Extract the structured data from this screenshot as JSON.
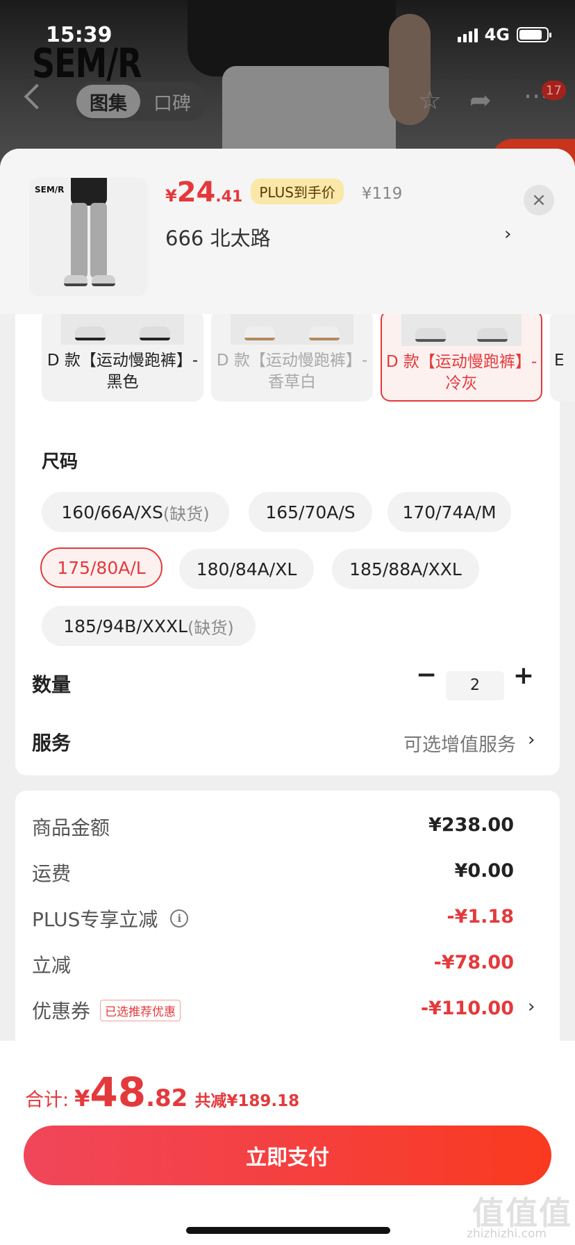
{
  "status_bar": {
    "time": "15:39",
    "network": "4G",
    "battery_level": 0.85
  },
  "background": {
    "brand_logo": "SEM/R"
  },
  "nav": {
    "tabs": [
      {
        "label": "图集",
        "active": true
      },
      {
        "label": "口碑",
        "active": false
      }
    ],
    "cart_badge": "17",
    "icons": [
      "back-icon",
      "star-icon",
      "share-icon",
      "more-icon"
    ]
  },
  "product": {
    "thumb_brand": "SEM/R",
    "price_symbol": "¥",
    "price_int": "24",
    "price_dec": ".41",
    "plus_tag": "PLUS到手价",
    "original_price": "¥119",
    "sku_name": "666  北太路",
    "close_icon": "×"
  },
  "colors": [
    {
      "label": "D 款【运动慢跑裤】-黑色",
      "state": "normal"
    },
    {
      "label": "D 款【运动慢跑裤】-香草白",
      "state": "disabled"
    },
    {
      "label": "D 款【运动慢跑裤】-冷灰",
      "state": "selected"
    },
    {
      "label": "E",
      "state": "normal"
    }
  ],
  "size": {
    "title": "尺码",
    "options": [
      {
        "label": "160/66A/XS",
        "note": "(缺货)",
        "state": "disabled"
      },
      {
        "label": "165/70A/S",
        "note": "",
        "state": "normal"
      },
      {
        "label": "170/74A/M",
        "note": "",
        "state": "normal"
      },
      {
        "label": "175/80A/L",
        "note": "",
        "state": "selected"
      },
      {
        "label": "180/84A/XL",
        "note": "",
        "state": "normal"
      },
      {
        "label": "185/88A/XXL",
        "note": "",
        "state": "normal"
      },
      {
        "label": "185/94B/XXXL",
        "note": "(缺货)",
        "state": "disabled"
      }
    ]
  },
  "quantity": {
    "label": "数量",
    "value": "2",
    "minus": "−",
    "plus": "+"
  },
  "service": {
    "label": "服务",
    "value": "可选增值服务",
    "arrow": "›"
  },
  "price_breakdown": [
    {
      "label": "商品金额",
      "value": "¥238.00",
      "red": false
    },
    {
      "label": "运费",
      "value": "¥0.00",
      "red": false
    },
    {
      "label": "PLUS专享立减",
      "value": "-¥1.18",
      "red": true,
      "info": "i"
    },
    {
      "label": "立减",
      "value": "-¥78.00",
      "red": true
    },
    {
      "label": "优惠券",
      "value": "-¥110.00",
      "red": true,
      "tag": "已选推荐优惠",
      "arrow": "›"
    }
  ],
  "total": {
    "label": "合计:",
    "symbol": "¥",
    "int": "48",
    "dec": ".82",
    "saved": "共减¥189.18"
  },
  "pay_button": "立即支付",
  "watermark": {
    "main": "值值值",
    "sub": "zhizhizhi.com"
  },
  "colors_theme": {
    "accent": "#e4393c",
    "plus_tag_bg": "#f9e8a7"
  }
}
